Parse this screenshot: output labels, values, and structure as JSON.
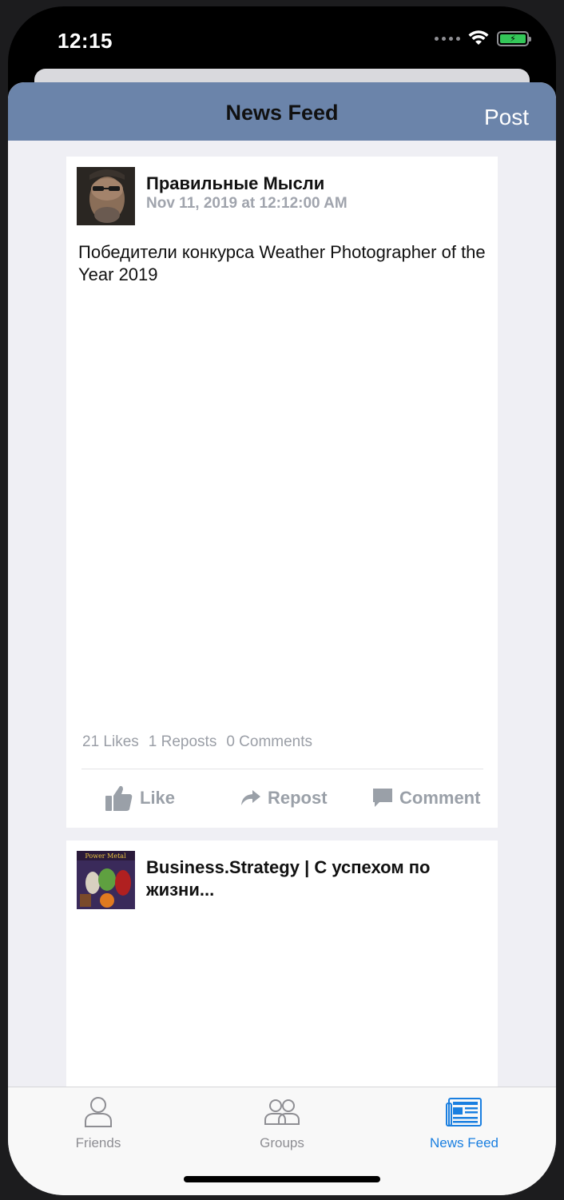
{
  "status_bar": {
    "time": "12:15"
  },
  "navbar": {
    "title": "News Feed",
    "post_label": "Post"
  },
  "posts": [
    {
      "author": "Правильные Мысли",
      "date": "Nov 11, 2019 at 12:12:00 AM",
      "text": "Победители конкурса Weather Photographer of the Year 2019",
      "likes": "21 Likes",
      "reposts": "1 Reposts",
      "comments": "0 Comments",
      "actions": {
        "like": "Like",
        "repost": "Repost",
        "comment": "Comment"
      }
    },
    {
      "author": "Business.Strategy | С успехом по жизни...",
      "avatar_text": "Power Metal"
    }
  ],
  "tabbar": {
    "items": [
      {
        "label": "Friends",
        "icon": "person-icon"
      },
      {
        "label": "Groups",
        "icon": "group-icon"
      },
      {
        "label": "News Feed",
        "icon": "newspaper-icon"
      }
    ],
    "active_color": "#1a7fe0",
    "inactive_color": "#8e8e93"
  },
  "colors": {
    "navbar": "#6b84aa",
    "background": "#efeff4"
  }
}
